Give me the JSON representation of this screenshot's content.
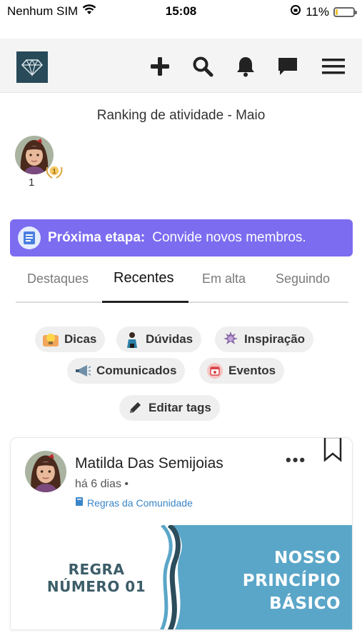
{
  "status": {
    "carrier": "Nenhum SIM",
    "time": "15:08",
    "battery": "11%",
    "battery_level": 0.11
  },
  "header": {
    "icons": [
      "diamond-logo",
      "plus-icon",
      "search-icon",
      "bell-icon",
      "chat-icon",
      "menu-icon"
    ]
  },
  "ranking": {
    "title": "Ranking de atividade - Maio",
    "position": "1",
    "medal": "1"
  },
  "banner": {
    "strong": "Próxima etapa:",
    "text": "Convide novos membros."
  },
  "tabs": [
    {
      "label": "Destaques"
    },
    {
      "label": "Recentes"
    },
    {
      "label": "Em alta"
    },
    {
      "label": "Seguindo"
    }
  ],
  "chips": [
    {
      "label": "Dicas",
      "icon": "lightbulb-icon"
    },
    {
      "label": "Dúvidas",
      "icon": "person-question-icon"
    },
    {
      "label": "Inspiração",
      "icon": "statue-icon"
    },
    {
      "label": "Comunicados",
      "icon": "megaphone-icon"
    },
    {
      "label": "Eventos",
      "icon": "calendar-icon"
    },
    {
      "label": "Editar tags",
      "icon": "pencil-icon"
    }
  ],
  "post": {
    "author": "Matilda Das Semijoias",
    "time": "há 6 dias •",
    "tag": "Regras da Comunidade",
    "more": "•••",
    "image_left_line1": "REGRA",
    "image_left_line2": "NÚMERO 01",
    "image_right_line1": "NOSSO",
    "image_right_line2": "PRINCÍPIO",
    "image_right_line3": "BÁSICO"
  },
  "colors": {
    "banner": "#7c6cf0",
    "logo_bg": "#284a59",
    "link": "#3a86c8",
    "image_blue": "#5aa6c8"
  }
}
